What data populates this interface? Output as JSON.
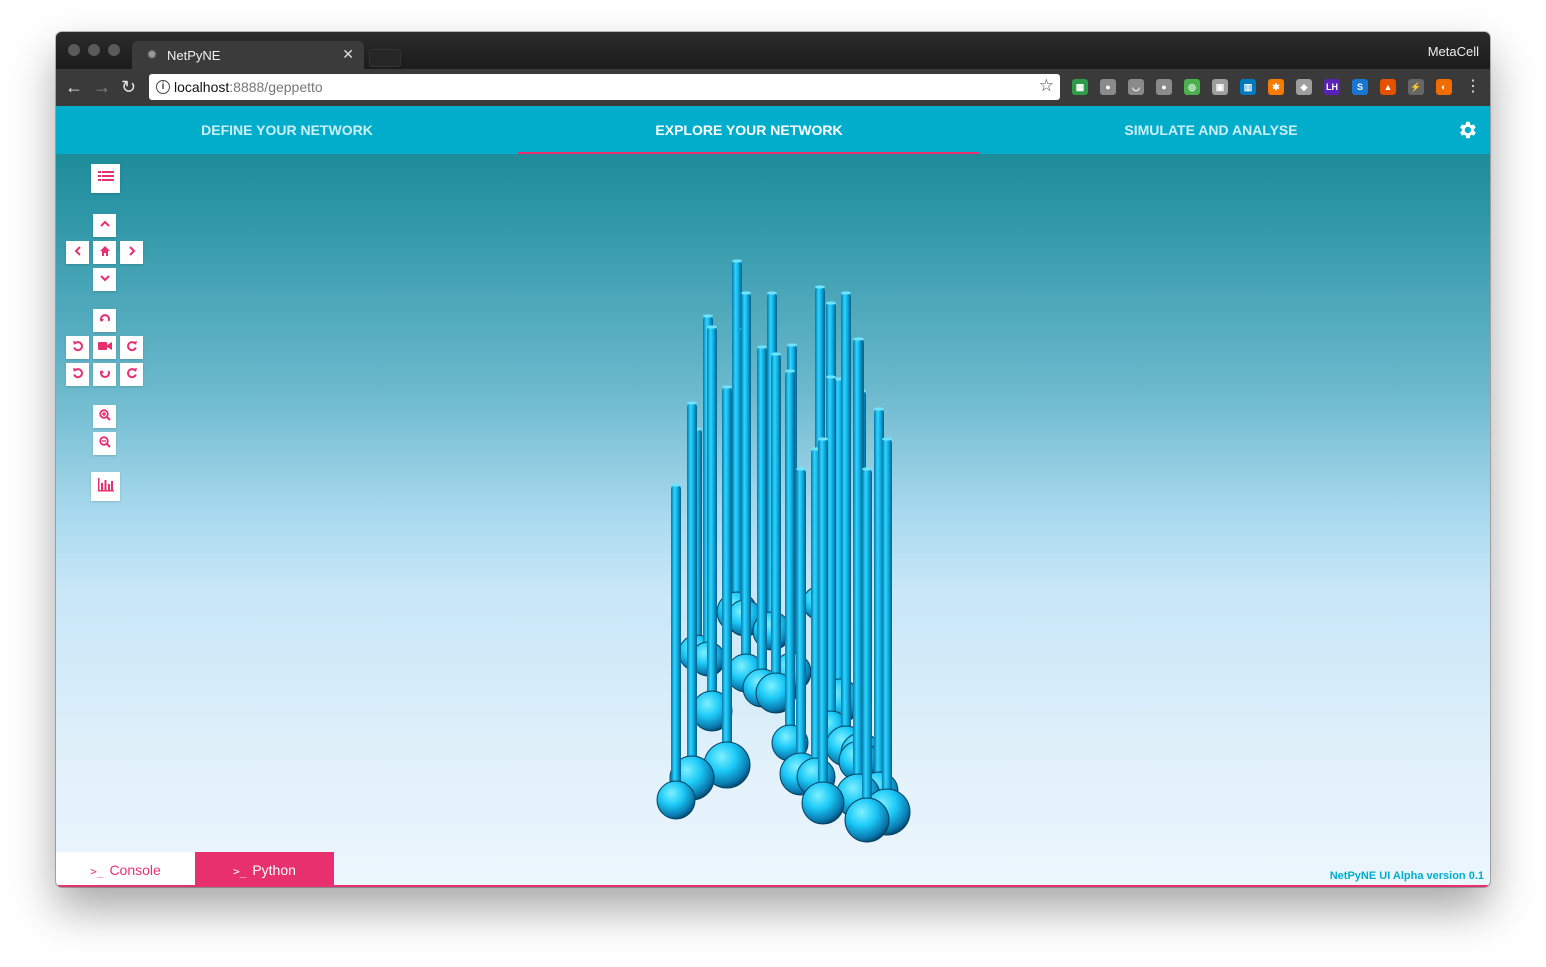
{
  "browser": {
    "tab_title": "NetPyNE",
    "tab_close": "✕",
    "profile_name": "MetaCell",
    "url_host": "localhost",
    "url_path": ":8888/geppetto",
    "extensions": [
      {
        "name": "google-sheets-ext-icon",
        "color": "#2e9b48",
        "glyph": "▦"
      },
      {
        "name": "onepassword-ext-icon",
        "color": "#8a8a8a",
        "glyph": "●"
      },
      {
        "name": "pocket-ext-icon",
        "color": "#8a8a8a",
        "glyph": "◡"
      },
      {
        "name": "ghost-ext-icon",
        "color": "#8a8a8a",
        "glyph": "●"
      },
      {
        "name": "screenshot-ext-icon",
        "color": "#4caf50",
        "glyph": "◎"
      },
      {
        "name": "evernote-ext-icon",
        "color": "#9e9e9e",
        "glyph": "▣"
      },
      {
        "name": "trello-ext-icon",
        "color": "#0079bf",
        "glyph": "▥"
      },
      {
        "name": "hubspot-ext-icon",
        "color": "#f57c00",
        "glyph": "✱"
      },
      {
        "name": "postman-ext-icon",
        "color": "#9e9e9e",
        "glyph": "◆"
      },
      {
        "name": "lighthouse-ext-icon",
        "color": "#5b21b6",
        "glyph": "LH"
      },
      {
        "name": "skype-ext-icon",
        "color": "#1976d2",
        "glyph": "S"
      },
      {
        "name": "metamask-ext-icon",
        "color": "#e65100",
        "glyph": "▲"
      },
      {
        "name": "lightning-ext-icon",
        "color": "#666666",
        "glyph": "⚡"
      },
      {
        "name": "firefox-ext-icon",
        "color": "#ef6c00",
        "glyph": "◐"
      }
    ]
  },
  "app": {
    "nav": {
      "tabs": [
        {
          "label": "DEFINE YOUR NETWORK"
        },
        {
          "label": "EXPLORE YOUR NETWORK"
        },
        {
          "label": "SIMULATE AND ANALYSE"
        }
      ],
      "active_tab": 1
    },
    "colors": {
      "accent": "#e8306f",
      "primary": "#00aecc",
      "neuron": "#14c8f5"
    },
    "bottom": {
      "console_label": "Console",
      "python_label": "Python",
      "prompt_glyph": ">_",
      "version": "NetPyNE UI Alpha version 0.1"
    }
  }
}
